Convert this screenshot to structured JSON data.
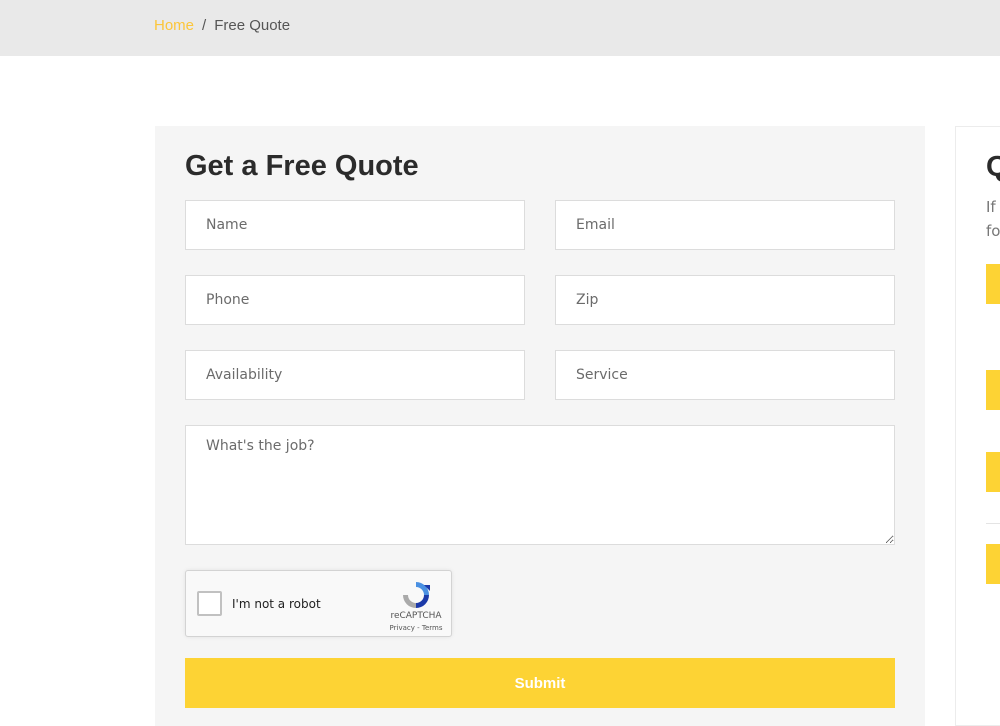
{
  "breadcrumb": {
    "home": "Home",
    "separator": "/",
    "current": "Free Quote"
  },
  "form": {
    "title": "Get a Free Quote",
    "fields": {
      "name": "Name",
      "email": "Email",
      "phone": "Phone",
      "zip": "Zip",
      "availability": "Availability",
      "service": "Service",
      "job": "What's the job?"
    },
    "captcha": {
      "label": "I'm not a robot",
      "brand": "reCAPTCHA",
      "terms": "Privacy - Terms"
    },
    "submit_label": "Submit"
  },
  "sidebar": {
    "title": "Q",
    "text_lines": [
      "If y",
      "fo"
    ],
    "icons": [
      "phone-icon",
      "envelope-icon",
      "map-marker-icon",
      "clock-icon"
    ]
  },
  "colors": {
    "accent": "#fdd334",
    "breadcrumb_link": "#fcc63a",
    "top_bar": "#e9e9e9",
    "form_background": "#f5f5f5",
    "title_text": "#2b2b2b"
  }
}
